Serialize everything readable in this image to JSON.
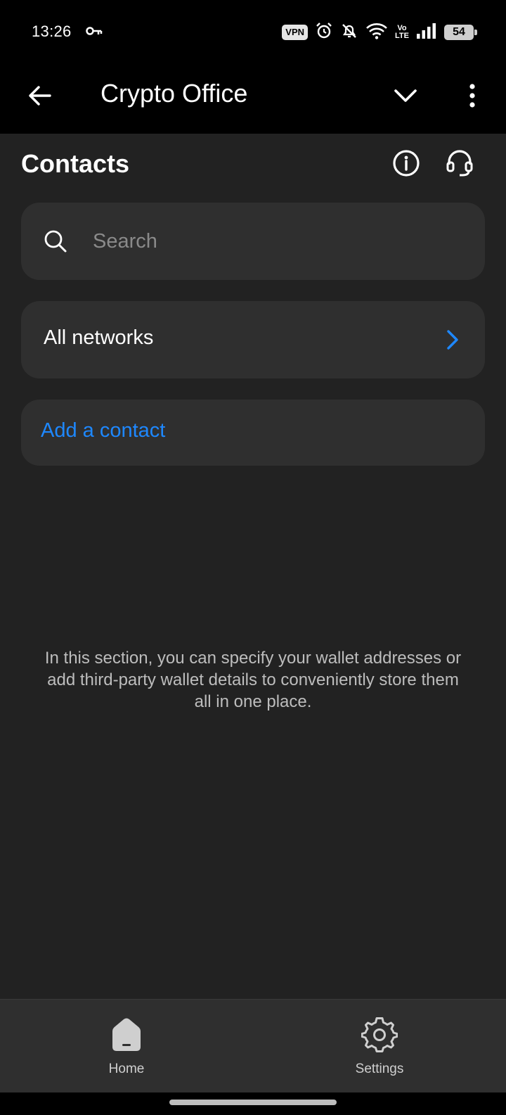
{
  "status_bar": {
    "time": "13:26",
    "vpn": "VPN",
    "volte_top": "Vo",
    "volte_bottom": "LTE",
    "battery": "54",
    "battery_level": 0.54
  },
  "app_bar": {
    "title": "Crypto Office"
  },
  "page": {
    "title": "Contacts"
  },
  "search": {
    "placeholder": "Search",
    "value": ""
  },
  "networks": {
    "label": "All networks"
  },
  "add_contact": {
    "label": "Add a contact"
  },
  "empty_state": {
    "text": "In this section, you can specify your wallet addresses or add third-party wallet details to conveniently store them all in one place."
  },
  "bottom_nav": {
    "items": [
      {
        "label": "Home",
        "icon": "home-icon"
      },
      {
        "label": "Settings",
        "icon": "gear-icon"
      }
    ]
  },
  "colors": {
    "accent": "#1e88ff",
    "background": "#222222",
    "card": "#2f2f2f"
  }
}
